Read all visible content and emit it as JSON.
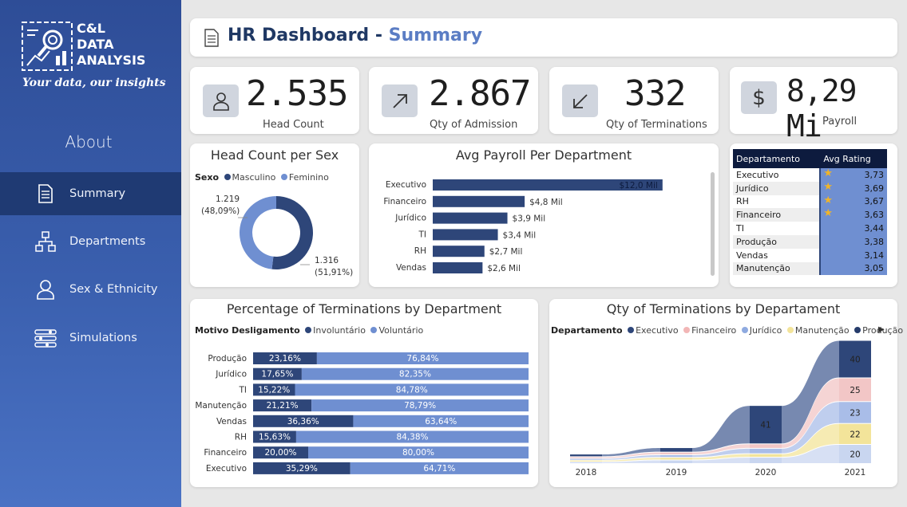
{
  "logo": {
    "line1": "C&L",
    "line2": "DATA",
    "line3": "ANALYSIS",
    "tagline": "Your data, our insights"
  },
  "sidebar": {
    "about": "About",
    "items": [
      {
        "label": "Summary",
        "icon": "document-icon",
        "active": true
      },
      {
        "label": "Departments",
        "icon": "org-chart-icon",
        "active": false
      },
      {
        "label": "Sex & Ethnicity",
        "icon": "person-icon",
        "active": false
      },
      {
        "label": "Simulations",
        "icon": "sliders-icon",
        "active": false
      }
    ]
  },
  "header": {
    "title": "HR Dashboard - ",
    "subtitle": "Summary"
  },
  "kpis": {
    "head_count": {
      "value": "2.535",
      "label": "Head Count"
    },
    "admission": {
      "value": "2.867",
      "label": "Qty of Admission"
    },
    "terminations": {
      "value": "332",
      "label": "Qty of Terminations"
    },
    "payroll": {
      "value": "8,29 Mi",
      "label": "Payroll"
    }
  },
  "colors": {
    "dark": "#2e4679",
    "light": "#6f8fd1",
    "sidebar": "#2e4d97",
    "highlight": "#5b7dc4"
  },
  "sex_chart": {
    "title": "Head Count per Sex",
    "legend_title": "Sexo",
    "legend": [
      "Masculino",
      "Feminino"
    ],
    "label_fem_value": "1.219",
    "label_fem_pct": "(48,09%)",
    "label_masc_value": "1.316",
    "label_masc_pct": "(51,91%)"
  },
  "payroll_chart": {
    "title": "Avg Payroll Per Department"
  },
  "rating_table": {
    "headers": [
      "Departamento",
      "Avg Rating"
    ],
    "rows": [
      {
        "dept": "Executivo",
        "rating": "3,73",
        "star": true
      },
      {
        "dept": "Jurídico",
        "rating": "3,69",
        "star": true
      },
      {
        "dept": "RH",
        "rating": "3,67",
        "star": true
      },
      {
        "dept": "Financeiro",
        "rating": "3,63",
        "star": true
      },
      {
        "dept": "TI",
        "rating": "3,44",
        "star": false
      },
      {
        "dept": "Produção",
        "rating": "3,38",
        "star": false
      },
      {
        "dept": "Vendas",
        "rating": "3,14",
        "star": false
      },
      {
        "dept": "Manutenção",
        "rating": "3,05",
        "star": false
      }
    ]
  },
  "term_pct_chart": {
    "title": "Percentage of Terminations by Department",
    "legend_title": "Motivo Desligamento",
    "legend": [
      "Involuntário",
      "Voluntário"
    ]
  },
  "term_qty_chart": {
    "title": "Qty of Terminations by Departament",
    "legend_title": "Departamento",
    "legend": [
      "Executivo",
      "Financeiro",
      "Jurídico",
      "Manutenção",
      "Produção"
    ]
  },
  "chart_data": [
    {
      "type": "pie",
      "title": "Head Count per Sex",
      "categories": [
        "Masculino",
        "Feminino"
      ],
      "values": [
        1316,
        1219
      ],
      "labels": [
        "1.316 (51,91%)",
        "1.219 (48,09%)"
      ]
    },
    {
      "type": "bar",
      "title": "Avg Payroll Per Department",
      "categories": [
        "Executivo",
        "Financeiro",
        "Jurídico",
        "TI",
        "RH",
        "Vendas"
      ],
      "values": [
        12.0,
        4.8,
        3.9,
        3.4,
        2.7,
        2.6
      ],
      "labels": [
        "$12,0 Mil",
        "$4,8 Mil",
        "$3,9 Mil",
        "$3,4 Mil",
        "$2,7 Mil",
        "$2,6 Mil"
      ]
    },
    {
      "type": "bar",
      "title": "Percentage of Terminations by Department",
      "categories": [
        "Produção",
        "Jurídico",
        "TI",
        "Manutenção",
        "Vendas",
        "RH",
        "Financeiro",
        "Executivo"
      ],
      "series": [
        {
          "name": "Involuntário",
          "values": [
            23.16,
            17.65,
            15.22,
            21.21,
            36.36,
            15.63,
            20.0,
            35.29
          ],
          "labels": [
            "23,16%",
            "17,65%",
            "15,22%",
            "21,21%",
            "36,36%",
            "15,63%",
            "20,00%",
            "35,29%"
          ]
        },
        {
          "name": "Voluntário",
          "values": [
            76.84,
            82.35,
            84.78,
            78.79,
            63.64,
            84.38,
            80.0,
            64.71
          ],
          "labels": [
            "76,84%",
            "82,35%",
            "84,78%",
            "78,79%",
            "63,64%",
            "84,38%",
            "80,00%",
            "64,71%"
          ]
        }
      ]
    },
    {
      "type": "area",
      "title": "Qty of Terminations by Departament",
      "x": [
        "2018",
        "2019",
        "2020",
        "2021"
      ],
      "series": [
        {
          "name": "Executivo",
          "values": [
            2,
            4,
            41,
            40
          ]
        },
        {
          "name": "Financeiro",
          "values": [
            1,
            2,
            4,
            25
          ]
        },
        {
          "name": "Jurídico",
          "values": [
            1,
            2,
            5,
            23
          ]
        },
        {
          "name": "Manutenção",
          "values": [
            1,
            2,
            3,
            22
          ]
        },
        {
          "name": "Produção",
          "values": [
            1,
            3,
            6,
            20
          ]
        }
      ],
      "data_labels": [
        "41",
        "40",
        "25",
        "23",
        "22",
        "20"
      ]
    }
  ]
}
